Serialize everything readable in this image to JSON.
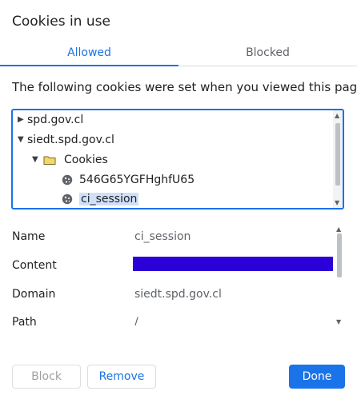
{
  "dialog": {
    "title": "Cookies in use"
  },
  "tabs": [
    {
      "label": "Allowed"
    },
    {
      "label": "Blocked"
    }
  ],
  "description": "The following cookies were set when you viewed this page",
  "tree": {
    "items": [
      {
        "label": "spd.gov.cl",
        "expanded": false
      },
      {
        "label": "siedt.spd.gov.cl",
        "expanded": true
      },
      {
        "label": "Cookies",
        "icon": "folder-icon",
        "expanded": true
      },
      {
        "label": "546G65YGFHghfU65",
        "icon": "cookie-icon"
      },
      {
        "label": "ci_session",
        "icon": "cookie-icon",
        "selected": true
      }
    ]
  },
  "details": {
    "rows": [
      {
        "label": "Name",
        "value": "ci_session"
      },
      {
        "label": "Content",
        "value": "",
        "redacted_color": "#2c00d8"
      },
      {
        "label": "Domain",
        "value": "siedt.spd.gov.cl"
      },
      {
        "label": "Path",
        "value": "/"
      }
    ]
  },
  "buttons": {
    "block": "Block",
    "remove": "Remove",
    "done": "Done"
  },
  "colors": {
    "accent": "#1a73e8",
    "selection": "#cfe0f7"
  }
}
